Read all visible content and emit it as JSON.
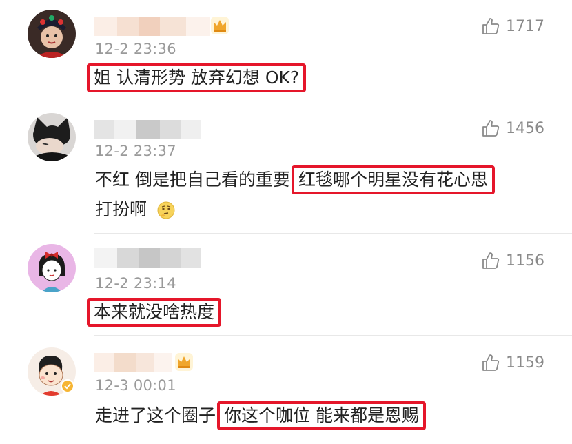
{
  "colors": {
    "highlight": "#e5162a",
    "time": "#9a9a9a",
    "like": "#8a8a8a",
    "crown": "#f0a62b"
  },
  "comments": [
    {
      "avatar_icon": "opera-mask-avatar",
      "time": "12-2 23:36",
      "likes": "1717",
      "has_crown": true,
      "text_plain": "",
      "text_highlight": "姐 认清形势 放弃幻想 OK?",
      "text_line2": ""
    },
    {
      "avatar_icon": "cat-ear-avatar",
      "time": "12-2 23:37",
      "likes": "1456",
      "has_crown": false,
      "text_plain": "不红 倒是把自己看的重要",
      "text_highlight": "红毯哪个明星没有花心思",
      "text_line2": "打扮啊"
    },
    {
      "avatar_icon": "cartoon-girl-avatar",
      "time": "12-2 23:14",
      "likes": "1156",
      "has_crown": false,
      "text_plain": "",
      "text_highlight": "本来就没啥热度",
      "text_line2": ""
    },
    {
      "avatar_icon": "crayon-shin-avatar",
      "time": "12-3 00:01",
      "likes": "1159",
      "has_crown": true,
      "text_plain": "走进了这个圈子",
      "text_highlight": "你这个咖位 能来都是恩赐",
      "text_line2": ""
    }
  ]
}
